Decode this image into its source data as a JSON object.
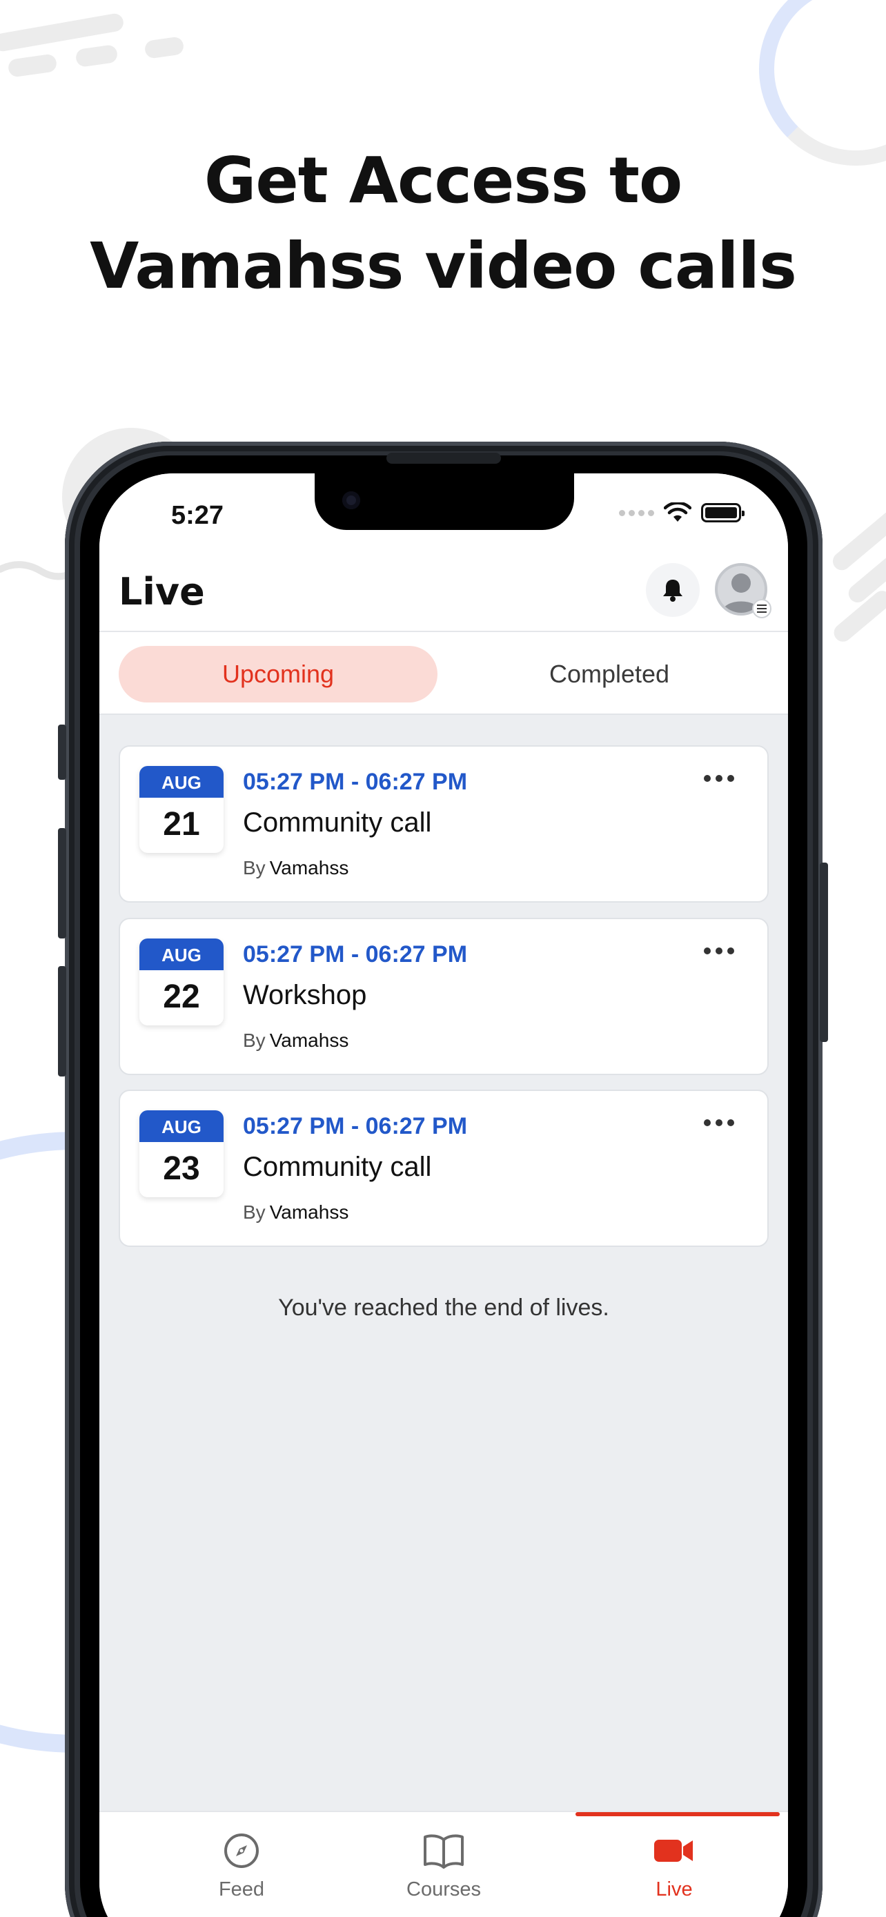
{
  "promo": {
    "headline_line1": "Get Access to",
    "headline_line2": "Vamahss video calls"
  },
  "status_bar": {
    "time": "5:27",
    "icons": [
      "signal-icon",
      "wifi-icon",
      "battery-icon"
    ]
  },
  "header": {
    "title": "Live",
    "icons": [
      "bell-icon",
      "avatar-icon",
      "menu-icon"
    ]
  },
  "tabs": [
    {
      "label": "Upcoming",
      "active": true
    },
    {
      "label": "Completed",
      "active": false
    }
  ],
  "events": [
    {
      "month": "AUG",
      "day": "21",
      "time": "05:27 PM - 06:27 PM",
      "title": "Community call",
      "by_label": "By",
      "host": "Vamahss"
    },
    {
      "month": "AUG",
      "day": "22",
      "time": "05:27 PM - 06:27 PM",
      "title": "Workshop",
      "by_label": "By",
      "host": "Vamahss"
    },
    {
      "month": "AUG",
      "day": "23",
      "time": "05:27 PM - 06:27 PM",
      "title": "Community call",
      "by_label": "By",
      "host": "Vamahss"
    }
  ],
  "end_message": "You've reached the end of lives.",
  "bottom_nav": [
    {
      "label": "Feed",
      "icon": "compass-icon",
      "active": false
    },
    {
      "label": "Courses",
      "icon": "book-icon",
      "active": false
    },
    {
      "label": "Live",
      "icon": "video-camera-icon",
      "active": true
    }
  ],
  "colors": {
    "accent_red": "#e2321e",
    "accent_blue": "#2258c9",
    "tab_active_bg": "#fbdbd6",
    "screen_bg": "#eceef1"
  }
}
